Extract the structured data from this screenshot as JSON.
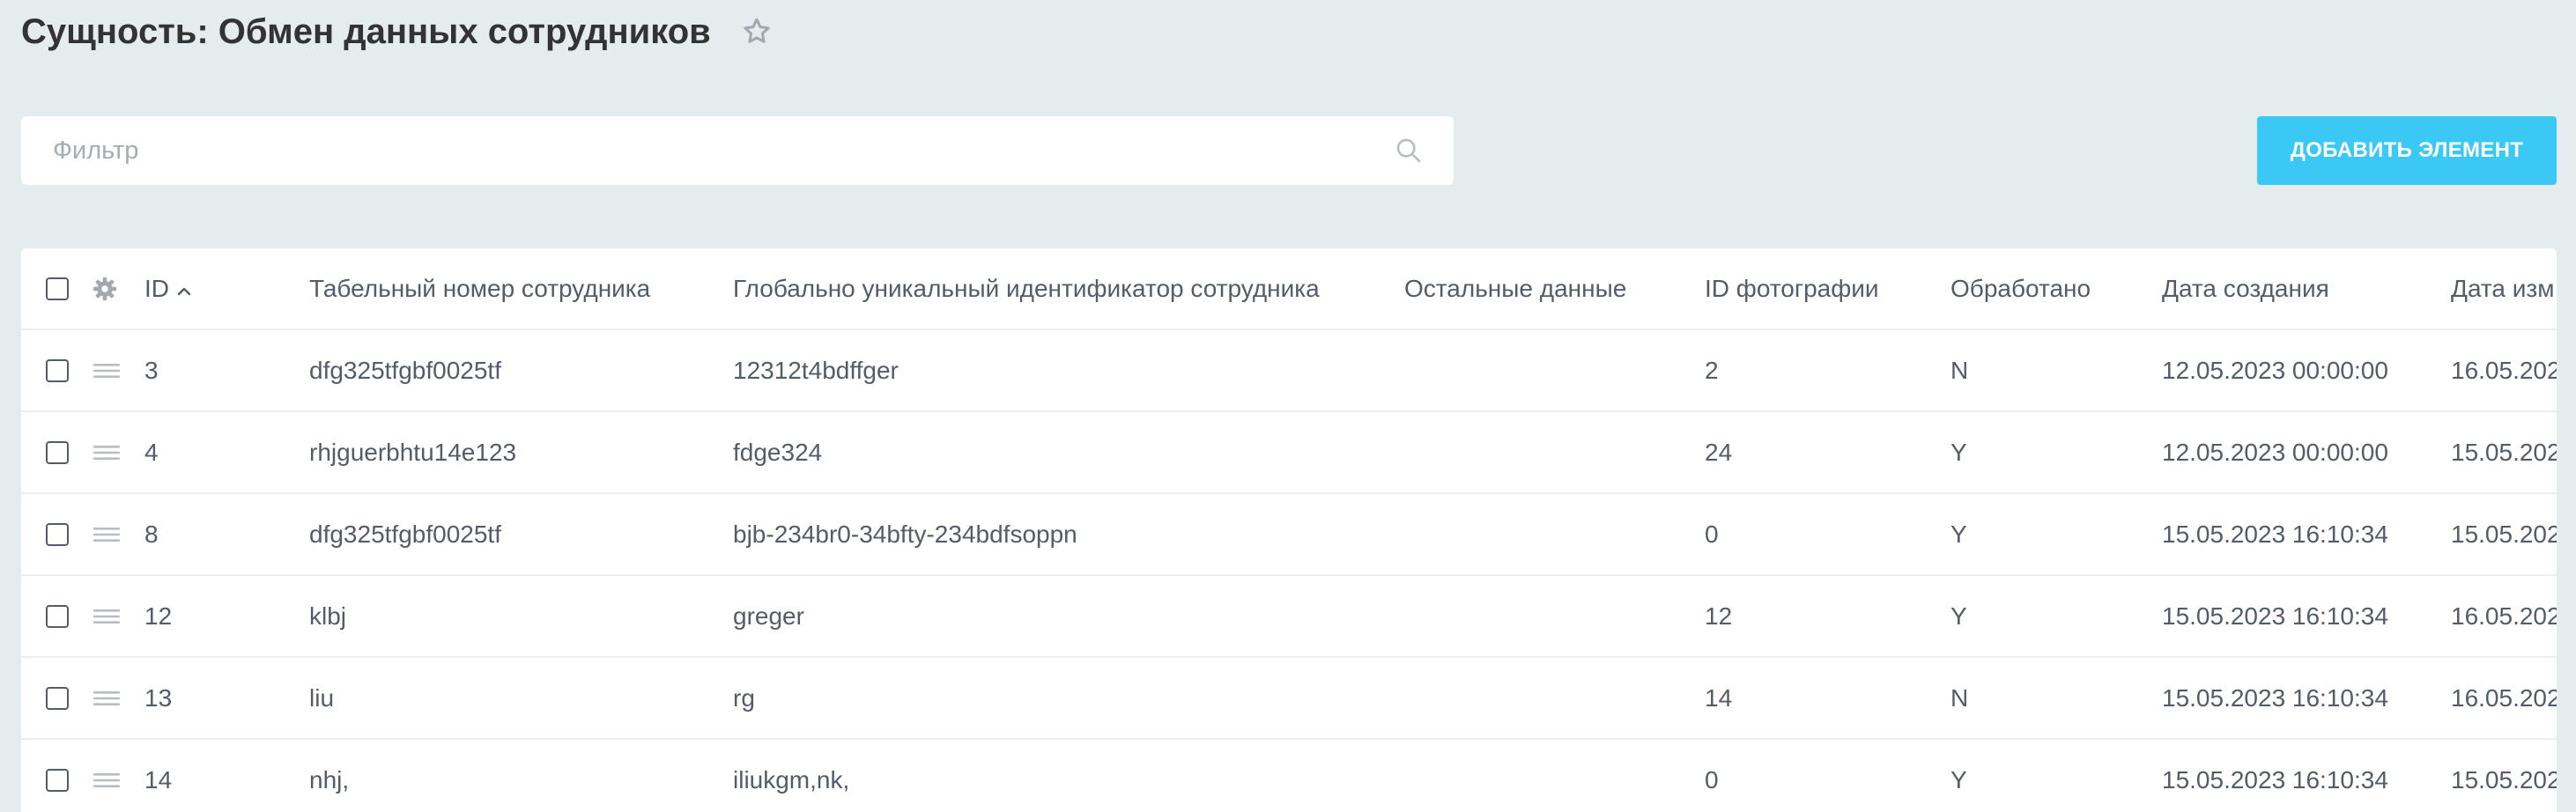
{
  "page": {
    "title": "Сущность: Обмен данных сотрудников"
  },
  "filter": {
    "placeholder": "Фильтр",
    "value": ""
  },
  "toolbar": {
    "add_label": "ДОБАВИТЬ ЭЛЕМЕНТ"
  },
  "icons": {
    "title": "star-icon",
    "filter": "search-icon",
    "settings": "gear-icon",
    "row_menu": "drag-handle-icon",
    "sort": "sort-ascending-icon"
  },
  "colors": {
    "background": "#e4ecee",
    "accent_button": "#3bc8f5",
    "text": "#535c69"
  },
  "table": {
    "columns": [
      "ID",
      "Табельный номер сотрудника",
      "Глобально уникальный идентификатор сотрудника",
      "Остальные данные",
      "ID фотографии",
      "Обработано",
      "Дата создания",
      "Дата изм"
    ],
    "sort": {
      "column": "ID",
      "direction": "asc"
    },
    "rows": [
      {
        "id": "3",
        "employee_no": "dfg325tfgbf0025tf",
        "guid": "12312t4bdffger",
        "other": "",
        "photo_id": "2",
        "processed": "N",
        "created": "12.05.2023 00:00:00",
        "modified": "16.05.202"
      },
      {
        "id": "4",
        "employee_no": "rhjguerbhtu14e123",
        "guid": "fdge324",
        "other": "",
        "photo_id": "24",
        "processed": "Y",
        "created": "12.05.2023 00:00:00",
        "modified": "15.05.202"
      },
      {
        "id": "8",
        "employee_no": "dfg325tfgbf0025tf",
        "guid": "bjb-234br0-34bfty-234bdfsoppn",
        "other": "",
        "photo_id": "0",
        "processed": "Y",
        "created": "15.05.2023 16:10:34",
        "modified": "15.05.202"
      },
      {
        "id": "12",
        "employee_no": "klbj",
        "guid": "greger",
        "other": "",
        "photo_id": "12",
        "processed": "Y",
        "created": "15.05.2023 16:10:34",
        "modified": "16.05.202"
      },
      {
        "id": "13",
        "employee_no": "liu",
        "guid": "rg",
        "other": "",
        "photo_id": "14",
        "processed": "N",
        "created": "15.05.2023 16:10:34",
        "modified": "16.05.202"
      },
      {
        "id": "14",
        "employee_no": "nhj,",
        "guid": "iliukgm,nk,",
        "other": "",
        "photo_id": "0",
        "processed": "Y",
        "created": "15.05.2023 16:10:34",
        "modified": "15.05.202"
      }
    ]
  }
}
